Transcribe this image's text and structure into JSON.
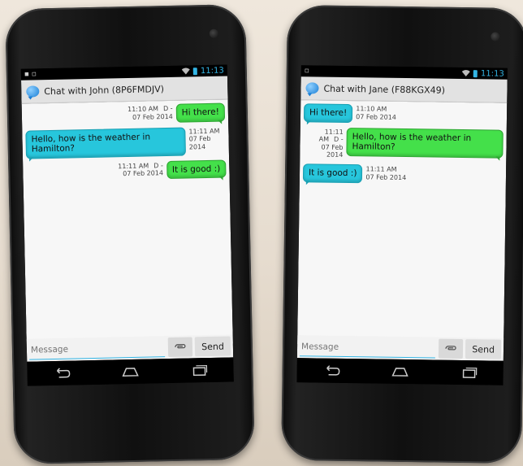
{
  "phones": [
    {
      "status_time": "11:13",
      "chat_title": "Chat with John (8P6FMDJV)",
      "messages": [
        {
          "side": "mine",
          "color": "green",
          "text": "Hi there!",
          "time": "11:10 AM",
          "flag": "D -",
          "date": "07 Feb 2014"
        },
        {
          "side": "theirs",
          "color": "cyan",
          "text": "Hello, how is the weather in Hamilton?",
          "time": "11:11 AM",
          "date": "07 Feb 2014"
        },
        {
          "side": "mine",
          "color": "green",
          "text": "It is good :)",
          "time": "11:11 AM",
          "flag": "D -",
          "date": "07 Feb 2014"
        }
      ],
      "input_placeholder": "Message",
      "send_label": "Send"
    },
    {
      "status_time": "11:13",
      "chat_title": "Chat with Jane (F88KGX49)",
      "messages": [
        {
          "side": "theirs",
          "color": "cyan",
          "text": "Hi there!",
          "time": "11:10 AM",
          "date": "07 Feb 2014"
        },
        {
          "side": "mine",
          "color": "green",
          "text": "Hello, how is the weather in Hamilton?",
          "time": "11:11 AM",
          "flag": "D -",
          "date": "07 Feb 2014"
        },
        {
          "side": "theirs",
          "color": "cyan",
          "text": "It is good :)",
          "time": "11:11 AM",
          "date": "07 Feb 2014"
        }
      ],
      "input_placeholder": "Message",
      "send_label": "Send"
    }
  ],
  "colors": {
    "sent_bubble": "#44e04a",
    "received_bubble": "#27c6dc",
    "accent": "#33b5e5"
  },
  "icons": [
    "app-chat-icon",
    "attach-icon",
    "back-icon",
    "home-icon",
    "recents-icon",
    "wifi-icon",
    "battery-icon"
  ]
}
